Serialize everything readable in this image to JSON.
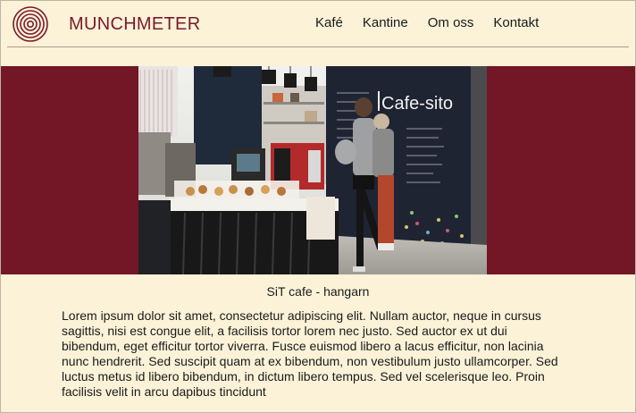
{
  "brand": {
    "name": "MUNCHMETER",
    "logo_icon": "concentric-circles-logo",
    "color": "#7a1a2a"
  },
  "nav": {
    "items": [
      {
        "label": "Kafé"
      },
      {
        "label": "Kantine"
      },
      {
        "label": "Om oss"
      },
      {
        "label": "Kontakt"
      }
    ]
  },
  "hero": {
    "background_color": "#731626",
    "image_sign_text": "Cafe-sito",
    "caption": "SiT cafe - hangarn"
  },
  "article": {
    "text": "Lorem ipsum dolor sit amet, consectetur adipiscing elit. Nullam auctor, neque in cursus sagittis, nisi est congue elit, a facilisis tortor lorem nec justo. Sed auctor ex ut dui bibendum, eget efficitur tortor viverra. Fusce euismod libero a lacus efficitur, non lacinia nunc hendrerit. Sed suscipit quam at ex bibendum, non vestibulum justo ullamcorper. Sed luctus metus id libero bibendum, in dictum libero tempus. Sed vel scelerisque leo. Proin facilisis velit in arcu dapibus tincidunt"
  },
  "colors": {
    "page_background": "#fbf2d8",
    "accent": "#731626"
  }
}
